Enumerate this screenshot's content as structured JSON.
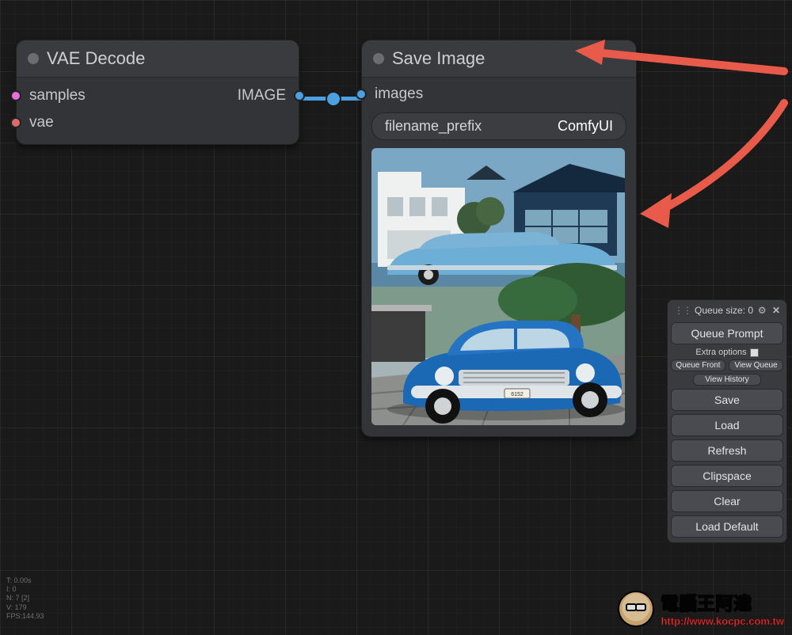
{
  "nodes": {
    "vae_decode": {
      "title": "VAE Decode",
      "inputs": {
        "samples": "samples",
        "vae": "vae"
      },
      "outputs": {
        "image": "IMAGE"
      }
    },
    "save_image": {
      "title": "Save Image",
      "inputs": {
        "images": "images"
      },
      "widget": {
        "label": "filename_prefix",
        "value": "ComfyUI"
      }
    }
  },
  "panel": {
    "queue_label": "Queue size: 0",
    "queue_prompt": "Queue Prompt",
    "extra_options": "Extra options",
    "queue_front": "Queue Front",
    "view_queue": "View Queue",
    "view_history": "View History",
    "save": "Save",
    "load": "Load",
    "refresh": "Refresh",
    "clipspace": "Clipspace",
    "clear": "Clear",
    "load_default": "Load Default"
  },
  "stats": {
    "t": "T: 0.00s",
    "i": "I: 0",
    "n": "N: 7 [2]",
    "v": "V: 179",
    "fps": "FPS:144.93"
  },
  "watermark": {
    "title": "電腦王阿達",
    "url": "http://www.kocpc.com.tw"
  }
}
